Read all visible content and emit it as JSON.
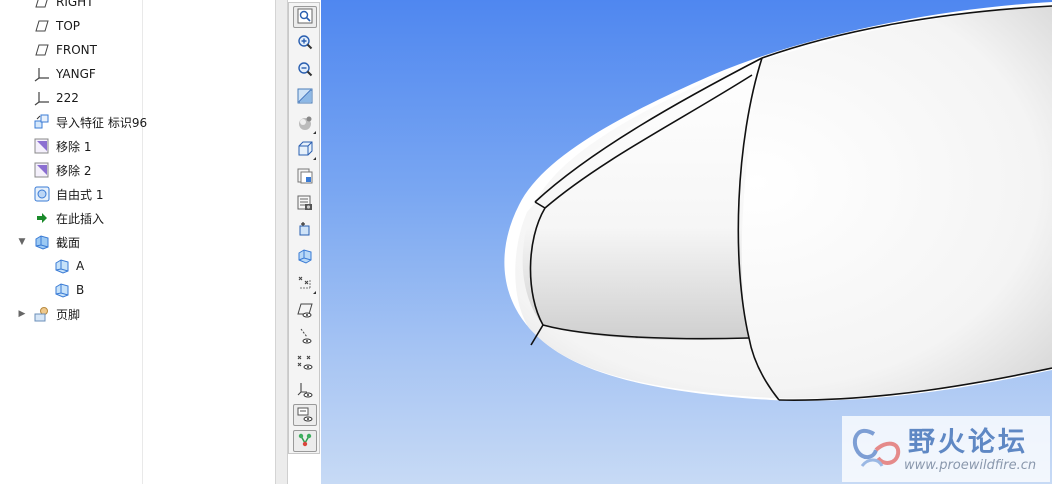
{
  "model_tree": {
    "items": [
      {
        "label": "RIGHT",
        "icon": "datum-plane-icon"
      },
      {
        "label": "TOP",
        "icon": "datum-plane-icon"
      },
      {
        "label": "FRONT",
        "icon": "datum-plane-icon"
      },
      {
        "label": "YANGF",
        "icon": "coordinate-system-icon"
      },
      {
        "label": "222",
        "icon": "coordinate-system-icon"
      },
      {
        "label": "导入特征 标识96",
        "icon": "import-feature-icon"
      },
      {
        "label": "移除 1",
        "icon": "remove-feature-icon"
      },
      {
        "label": "移除 2",
        "icon": "remove-feature-icon"
      },
      {
        "label": "自由式 1",
        "icon": "freestyle-icon"
      },
      {
        "label": "在此插入",
        "icon": "insert-here-arrow-icon"
      },
      {
        "label": "截面",
        "icon": "cross-section-icon",
        "expanded": true
      },
      {
        "label": "A",
        "icon": "section-icon"
      },
      {
        "label": "B",
        "icon": "section-icon"
      },
      {
        "label": "页脚",
        "icon": "footer-icon",
        "expanded": false
      }
    ]
  },
  "view_toolbar": {
    "buttons": [
      {
        "name": "refit-icon"
      },
      {
        "name": "zoom-in-icon"
      },
      {
        "name": "zoom-out-icon"
      },
      {
        "name": "repaint-icon"
      },
      {
        "name": "display-style-icon"
      },
      {
        "name": "saved-orientations-icon"
      },
      {
        "name": "view-manager-icon"
      },
      {
        "name": "appearance-gallery-icon"
      },
      {
        "name": "perspective-view-icon"
      },
      {
        "name": "spin-center-icon"
      },
      {
        "name": "annotation-display-icon"
      },
      {
        "name": "plane-display-icon"
      },
      {
        "name": "axis-display-icon"
      },
      {
        "name": "point-display-icon"
      },
      {
        "name": "csys-display-icon"
      },
      {
        "name": "tag-display-icon"
      },
      {
        "name": "network-display-icon"
      }
    ]
  },
  "watermark": {
    "title": "野火论坛",
    "url": "www.proewildfire.cn"
  },
  "colors": {
    "viewport_top": "#4f87f0",
    "viewport_bottom": "#c7daf5",
    "tree_icon": "#3a7bd5",
    "insert_arrow": "#1a8a2a"
  }
}
